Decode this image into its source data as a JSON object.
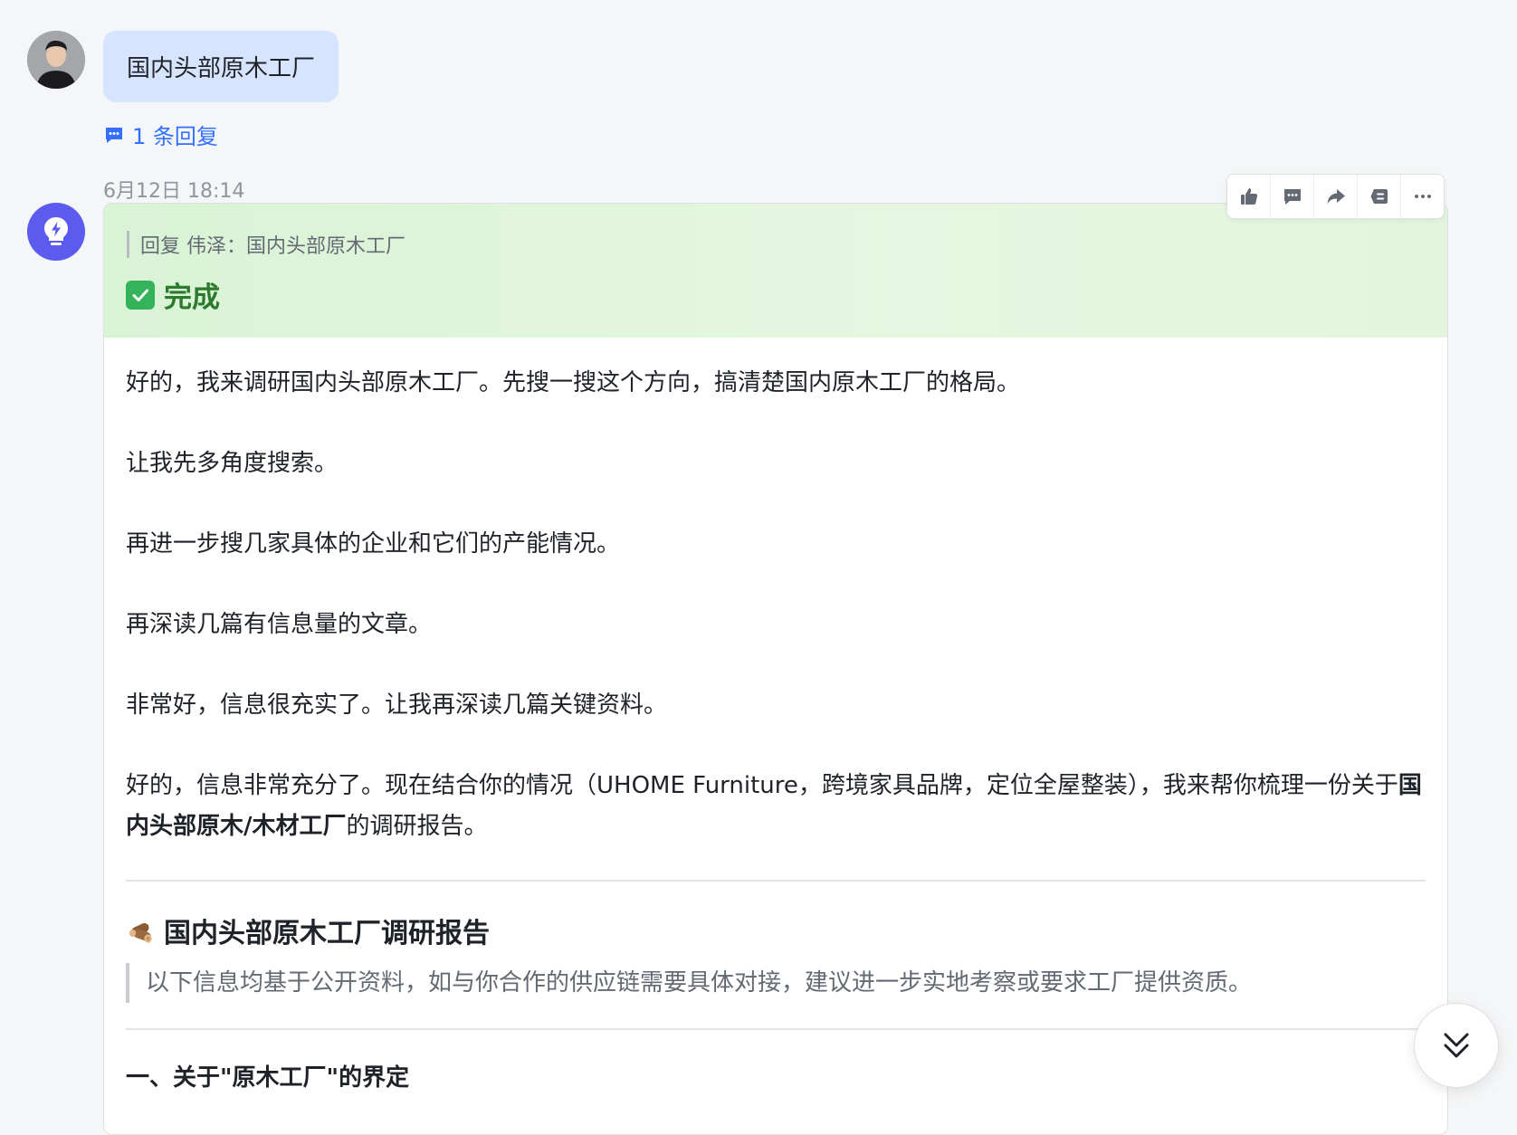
{
  "user_message": {
    "avatar": "user-avatar-photo",
    "text": "国内头部原木工厂",
    "reply_count_label": "1 条回复",
    "reply_icon": "comment-icon"
  },
  "bot_message": {
    "timestamp": "6月12日 18:14",
    "avatar": "bot-lightbulb-icon",
    "quote": "回复 伟泽：国内头部原木工厂",
    "status_icon": "check-icon",
    "status": "完成",
    "paragraphs": [
      "好的，我来调研国内头部原木工厂。先搜一搜这个方向，搞清楚国内原木工厂的格局。",
      "让我先多角度搜索。",
      "再进一步搜几家具体的企业和它们的产能情况。",
      "再深读几篇有信息量的文章。",
      "非常好，信息很充实了。让我再深读几篇关键资料。"
    ],
    "final_para": {
      "prefix": "好的，信息非常充分了。现在结合你的情况（UHOME Furniture，跨境家具品牌，定位全屋整装），我来帮你梳理一份关于",
      "bold": "国内头部原木/木材工厂",
      "suffix": "的调研报告。"
    },
    "report": {
      "icon": "wood-log-icon",
      "title": "国内头部原木工厂调研报告",
      "note": "以下信息均基于公开资料，如与你合作的供应链需要具体对接，建议进一步实地考察或要求工厂提供资质。",
      "section_1_heading": "一、关于\"原木工厂\"的界定"
    }
  },
  "toolbar": {
    "buttons": [
      "thumbs-up-icon",
      "comment-icon",
      "forward-icon",
      "reference-icon",
      "more-icon"
    ]
  },
  "scroll_button": {
    "icon": "double-chevron-down-icon"
  },
  "colors": {
    "page_bg": "#f5f6f7",
    "user_bubble": "#d6e4ff",
    "link_blue": "#3370ff",
    "header_green": "#d9f3d5",
    "status_green": "#2c7a2e",
    "bot_avatar": "#5b5bf0"
  }
}
